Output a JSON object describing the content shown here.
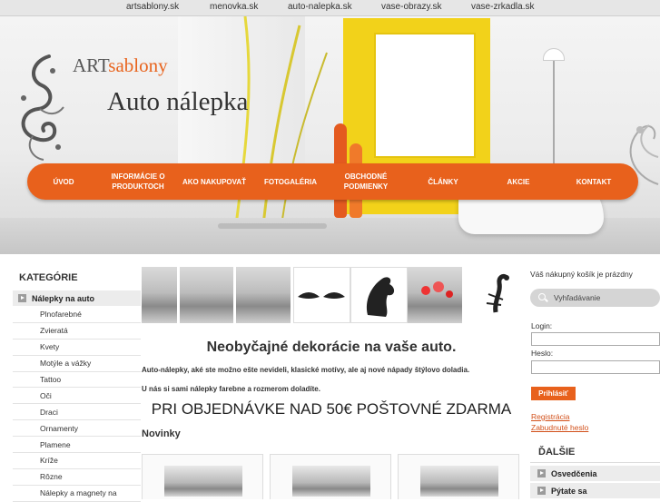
{
  "top_links": [
    "artsablony.sk",
    "menovka.sk",
    "auto-nalepka.sk",
    "vase-obrazy.sk",
    "vase-zrkadla.sk"
  ],
  "brand": {
    "part1": "ART",
    "part2": "sablony"
  },
  "site_title": "Auto nálepka",
  "nav": [
    {
      "label": "ÚVOD"
    },
    {
      "label": "INFORMÁCIE O PRODUKTOCH"
    },
    {
      "label": "AKO NAKUPOVAŤ"
    },
    {
      "label": "FOTOGALÉRIA"
    },
    {
      "label": "OBCHODNÉ PODMIENKY"
    },
    {
      "label": "ČLÁNKY"
    },
    {
      "label": "AKCIE"
    },
    {
      "label": "KONTAKT"
    }
  ],
  "sidebar": {
    "title": "KATEGÓRIE",
    "main_item": "Nálepky na auto",
    "items": [
      "Plnofarebné",
      "Zvieratá",
      "Kvety",
      "Motýle a vážky",
      "Tattoo",
      "Oči",
      "Draci",
      "Ornamenty",
      "Plamene",
      "Kríže",
      "Rôzne",
      "Nálepky a magnety na"
    ]
  },
  "main": {
    "headline": "Neobyčajné dekorácie na vaše auto.",
    "paragraph1": "Auto-nálepky, aké ste možno ešte nevideli, klasické motívy, ale aj nové nápady štýlovo doladia.",
    "paragraph2": "U nás si sami nálepky farebne a rozmerom doladíte.",
    "promo": "PRI OBJEDNÁVKE NAD 50€ POŠTOVNÉ ZDARMA",
    "novinky": "Novinky"
  },
  "right": {
    "cart": "Váš nákupný košík je prázdny",
    "search_placeholder": "Vyhľadávanie",
    "login_label": "Login:",
    "password_label": "Heslo:",
    "login_button": "Prihlásiť",
    "register_link": "Registrácia",
    "forgot_link": "Zabudnuté heslo",
    "more_title": "ĎALŠIE",
    "more_items": [
      "Osvedčenia",
      "Pýtate sa"
    ]
  },
  "colors": {
    "accent": "#e8611c",
    "yellow": "#f2d21a",
    "link": "#d2501a"
  }
}
